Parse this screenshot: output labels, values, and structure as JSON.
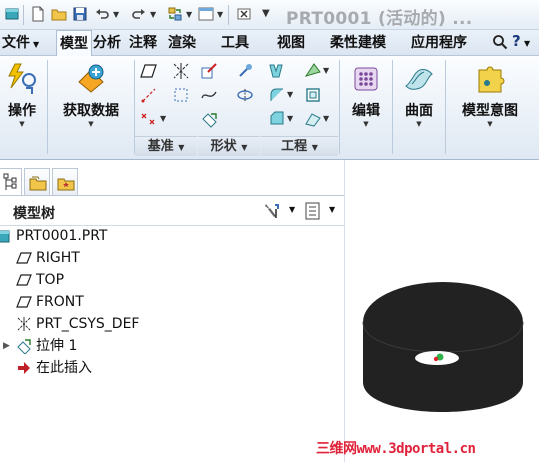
{
  "window": {
    "title": "PRT0001 (活动的) ..."
  },
  "tabs": [
    {
      "label": "文件",
      "has_menu": true
    },
    {
      "label": "模型"
    },
    {
      "label": "分析"
    },
    {
      "label": "注释"
    },
    {
      "label": "渲染"
    },
    {
      "label": "工具"
    },
    {
      "label": "视图"
    },
    {
      "label": "柔性建模"
    },
    {
      "label": "应用程序"
    }
  ],
  "ribbon": {
    "operations_label": "操作",
    "get_data_label": "获取数据",
    "edit_label": "编辑",
    "surface_label": "曲面",
    "design_intent_label": "模型意图",
    "groups": {
      "datum_label": "基准",
      "shapes_label": "形状",
      "engineering_label": "工程"
    }
  },
  "navigator": {
    "header": "模型树",
    "items": [
      {
        "label": "PRT0001.PRT",
        "icon": "part-icon"
      },
      {
        "label": "RIGHT",
        "icon": "datum-plane-icon"
      },
      {
        "label": "TOP",
        "icon": "datum-plane-icon"
      },
      {
        "label": "FRONT",
        "icon": "datum-plane-icon"
      },
      {
        "label": "PRT_CSYS_DEF",
        "icon": "coordinate-system-icon"
      },
      {
        "label": "拉伸 1",
        "icon": "extrude-icon",
        "expandable": true
      },
      {
        "label": "在此插入",
        "icon": "insert-here-arrow-icon"
      }
    ]
  },
  "watermark": "三维网www.3dportal.cn",
  "colors": {
    "ribbon_bg": "#e4ecf5",
    "model_fill": "#222222",
    "insert_arrow": "#c0202a",
    "watermark": "#e0233a"
  }
}
